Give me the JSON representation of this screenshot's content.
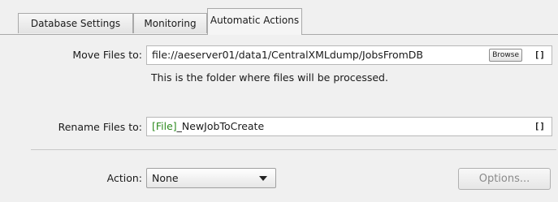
{
  "tabs": [
    {
      "label": "Database Settings"
    },
    {
      "label": "Monitoring"
    },
    {
      "label": "Automatic Actions"
    }
  ],
  "move_files": {
    "label": "Move Files to:",
    "value": "file://aeserver01/data1/CentralXMLdump/JobsFromDB",
    "browse_label": "Browse",
    "bracket_label": "[]",
    "hint": "This is the folder where files will be processed."
  },
  "rename_files": {
    "label": "Rename Files to:",
    "token": "[File]",
    "value": "_NewJobToCreate",
    "bracket_label": "[]"
  },
  "action": {
    "label": "Action:",
    "selected": "None"
  },
  "options_button": {
    "label": "Options...",
    "enabled": false
  },
  "colors": {
    "token": "#2e8b1f",
    "disabled_text": "#8a8a8a"
  }
}
